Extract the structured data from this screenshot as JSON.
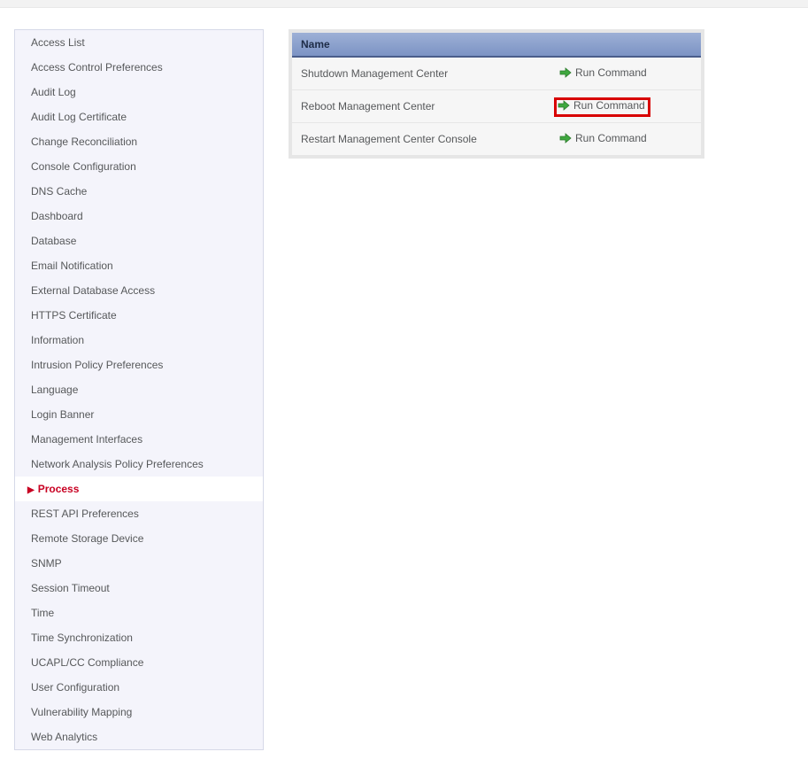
{
  "sidebar": {
    "items": [
      {
        "label": "Access List",
        "selected": false
      },
      {
        "label": "Access Control Preferences",
        "selected": false
      },
      {
        "label": "Audit Log",
        "selected": false
      },
      {
        "label": "Audit Log Certificate",
        "selected": false
      },
      {
        "label": "Change Reconciliation",
        "selected": false
      },
      {
        "label": "Console Configuration",
        "selected": false
      },
      {
        "label": "DNS Cache",
        "selected": false
      },
      {
        "label": "Dashboard",
        "selected": false
      },
      {
        "label": "Database",
        "selected": false
      },
      {
        "label": "Email Notification",
        "selected": false
      },
      {
        "label": "External Database Access",
        "selected": false
      },
      {
        "label": "HTTPS Certificate",
        "selected": false
      },
      {
        "label": "Information",
        "selected": false
      },
      {
        "label": "Intrusion Policy Preferences",
        "selected": false
      },
      {
        "label": "Language",
        "selected": false
      },
      {
        "label": "Login Banner",
        "selected": false
      },
      {
        "label": "Management Interfaces",
        "selected": false
      },
      {
        "label": "Network Analysis Policy Preferences",
        "selected": false
      },
      {
        "label": "Process",
        "selected": true
      },
      {
        "label": "REST API Preferences",
        "selected": false
      },
      {
        "label": "Remote Storage Device",
        "selected": false
      },
      {
        "label": "SNMP",
        "selected": false
      },
      {
        "label": "Session Timeout",
        "selected": false
      },
      {
        "label": "Time",
        "selected": false
      },
      {
        "label": "Time Synchronization",
        "selected": false
      },
      {
        "label": "UCAPL/CC Compliance",
        "selected": false
      },
      {
        "label": "User Configuration",
        "selected": false
      },
      {
        "label": "Vulnerability Mapping",
        "selected": false
      },
      {
        "label": "Web Analytics",
        "selected": false
      }
    ]
  },
  "table": {
    "header_name": "Name",
    "run_label": "Run Command",
    "rows": [
      {
        "name": "Shutdown Management Center",
        "highlight": false
      },
      {
        "name": "Reboot Management Center",
        "highlight": true
      },
      {
        "name": "Restart Management Center Console",
        "highlight": false
      }
    ]
  }
}
